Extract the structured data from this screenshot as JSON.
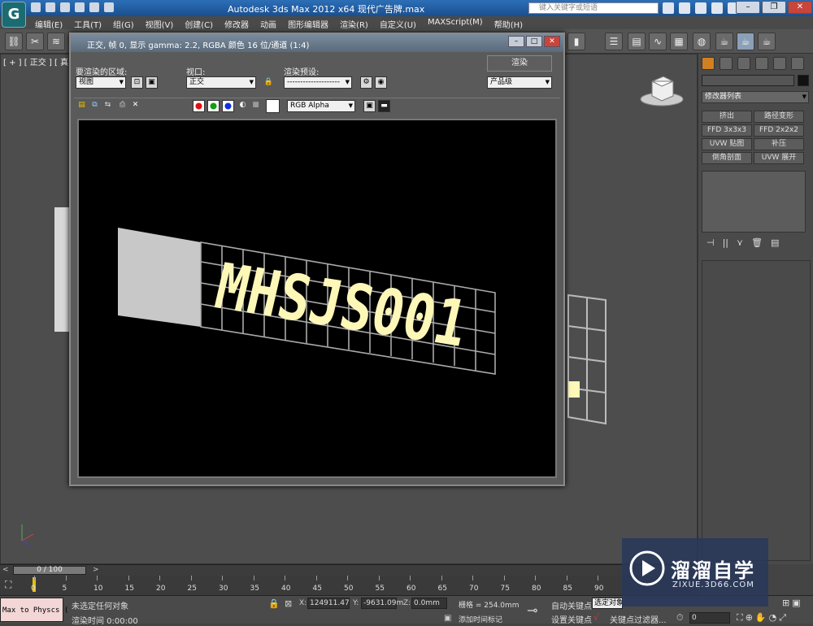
{
  "app": {
    "logo_letter": "G",
    "title": "Autodesk 3ds Max  2012 x64      现代广告牌.max",
    "search_placeholder": "键入关键字或短语"
  },
  "menubar": [
    "编辑(E)",
    "工具(T)",
    "组(G)",
    "视图(V)",
    "创建(C)",
    "修改器",
    "动画",
    "图形编辑器",
    "渲染(R)",
    "自定义(U)",
    "MAXScript(M)",
    "帮助(H)"
  ],
  "viewport": {
    "label": "[ + ] [ 正交 ] [ 真实 ]"
  },
  "render_window": {
    "title": "正交, 帧 0, 显示 gamma: 2.2, RGBA 颜色 16 位/通道 (1:4)",
    "area_label": "要渲染的区域:",
    "area_value": "视图",
    "viewport_label": "视口:",
    "viewport_value": "正交",
    "preset_label": "渲染预设:",
    "preset_value": "--------------------",
    "render_button": "渲染",
    "quality_value": "产品级",
    "channel_value": "RGB Alpha",
    "render_text": "MHSJS001",
    "colors": {
      "red": "#e01010",
      "green": "#10a010",
      "blue": "#1030e0",
      "text_fill": "#fdf7b8",
      "panel_fill": "#c8c8c8"
    }
  },
  "command_panel": {
    "modifier_list": "修改器列表",
    "modifier_buttons": [
      "挤出",
      "路径变形",
      "FFD 3x3x3",
      "FFD 2x2x2",
      "UVW 贴图",
      "补压",
      "倒角剖面",
      "UVW 展开"
    ]
  },
  "timeline": {
    "frame_display": "0 / 100",
    "tick_labels": [
      "0",
      "5",
      "10",
      "15",
      "20",
      "25",
      "30",
      "35",
      "40",
      "45",
      "50",
      "55",
      "60",
      "65",
      "70",
      "75",
      "80",
      "85",
      "90"
    ]
  },
  "status": {
    "script_field": "Max to Physcs (",
    "selection": "未选定任何对象",
    "render_time": "渲染时间  0:00:00",
    "x_label": "X:",
    "x_value": "124911.47",
    "y_label": "Y:",
    "y_value": "-9631.09m",
    "z_label": "Z:",
    "z_value": "0.0mm",
    "grid": "栅格 = 254.0mm",
    "add_time_tag": "添加时间标记",
    "auto_key": "自动关键点",
    "selected": "选定对象",
    "set_key": "设置关键点",
    "key_filter": "关键点过滤器...",
    "frame_field": "0"
  },
  "watermark": {
    "brand": "溜溜自学",
    "url": "ZIXUE.3D66.COM"
  }
}
